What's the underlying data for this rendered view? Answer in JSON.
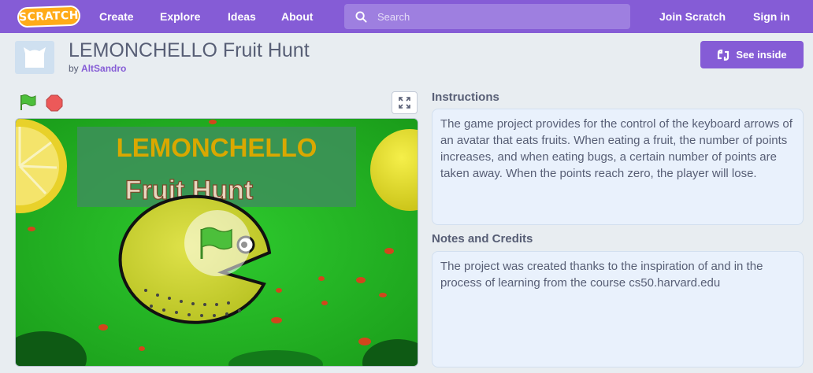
{
  "nav": {
    "logo_text": "SCRATCH",
    "links": [
      "Create",
      "Explore",
      "Ideas",
      "About"
    ],
    "search_placeholder": "Search",
    "join_label": "Join Scratch",
    "signin_label": "Sign in",
    "bg_color": "#855cd6"
  },
  "project": {
    "title": "LEMONCHELLO Fruit Hunt",
    "by_label": "by",
    "author": "AltSandro",
    "see_inside_label": "See inside"
  },
  "stage": {
    "title_line1": "LEMONCHELLO",
    "title_line2": "Fruit Hunt"
  },
  "instructions": {
    "heading": "Instructions",
    "text": "The game project provides for the control of the keyboard arrows of an avatar that eats fruits. When eating a fruit, the number of points increases, and when eating bugs, a certain number of points are taken away. When the points reach zero, the player will lose."
  },
  "notes": {
    "heading": "Notes and Credits",
    "text": "The project was created thanks to the inspiration of and in the process of learning from the course cs50.harvard.edu"
  }
}
